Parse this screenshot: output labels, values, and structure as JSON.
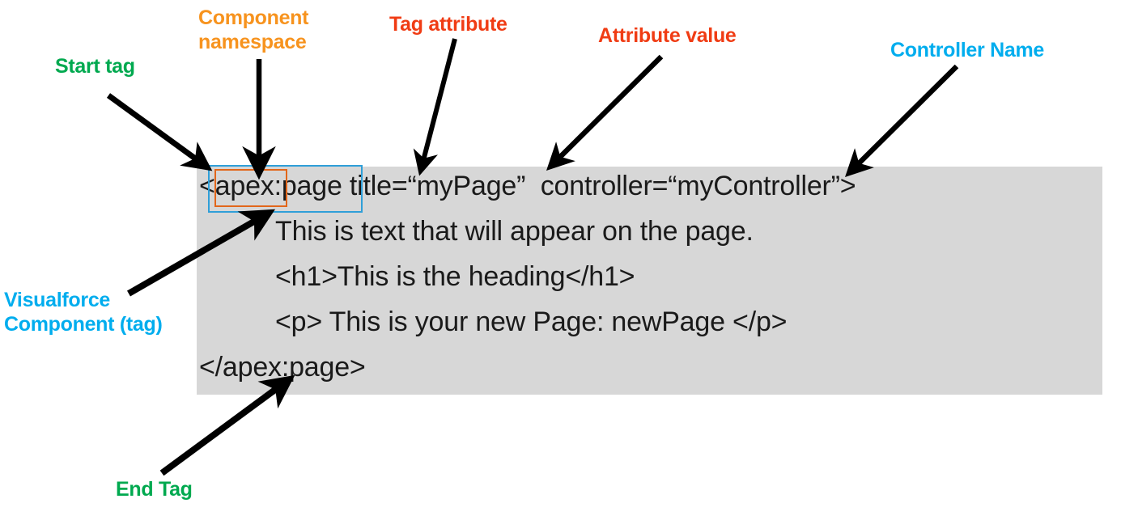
{
  "diagram": {
    "title": "Visualforce page markup annotated diagram",
    "background_color": "#ffffff",
    "code_block_color": "#d7d7d7"
  },
  "labels": {
    "start_tag": "Start tag",
    "component_namespace": "Component\nnamespace",
    "tag_attribute": "Tag attribute",
    "attribute_value": "Attribute value",
    "controller_name": "Controller Name",
    "visualforce_component": "Visualforce\nComponent (tag)",
    "end_tag": "End Tag"
  },
  "label_colors": {
    "green": "#00a94f",
    "orange": "#f7931e",
    "red": "#f03c14",
    "cyan": "#00adee"
  },
  "code": {
    "lines": [
      "<apex:page title=“myPage”  controller=“myController”>",
      "This is text that will appear on the page.",
      "<h1>This is the heading</h1>",
      "<p> This is your new Page: newPage </p>",
      "</apex:page>"
    ]
  },
  "highlight_boxes": {
    "visualforce_component": {
      "color": "#2f9fd8",
      "target_text": "apex:page"
    },
    "component_namespace": {
      "color": "#e2661a",
      "target_text": "apex:"
    }
  },
  "arrows": [
    {
      "name": "start-tag-arrow",
      "color": "#000000"
    },
    {
      "name": "component-namespace-arrow",
      "color": "#000000"
    },
    {
      "name": "tag-attribute-arrow",
      "color": "#000000"
    },
    {
      "name": "attribute-value-arrow",
      "color": "#000000"
    },
    {
      "name": "controller-name-arrow",
      "color": "#000000"
    },
    {
      "name": "visualforce-component-arrow",
      "color": "#000000"
    },
    {
      "name": "end-tag-arrow",
      "color": "#000000"
    }
  ]
}
